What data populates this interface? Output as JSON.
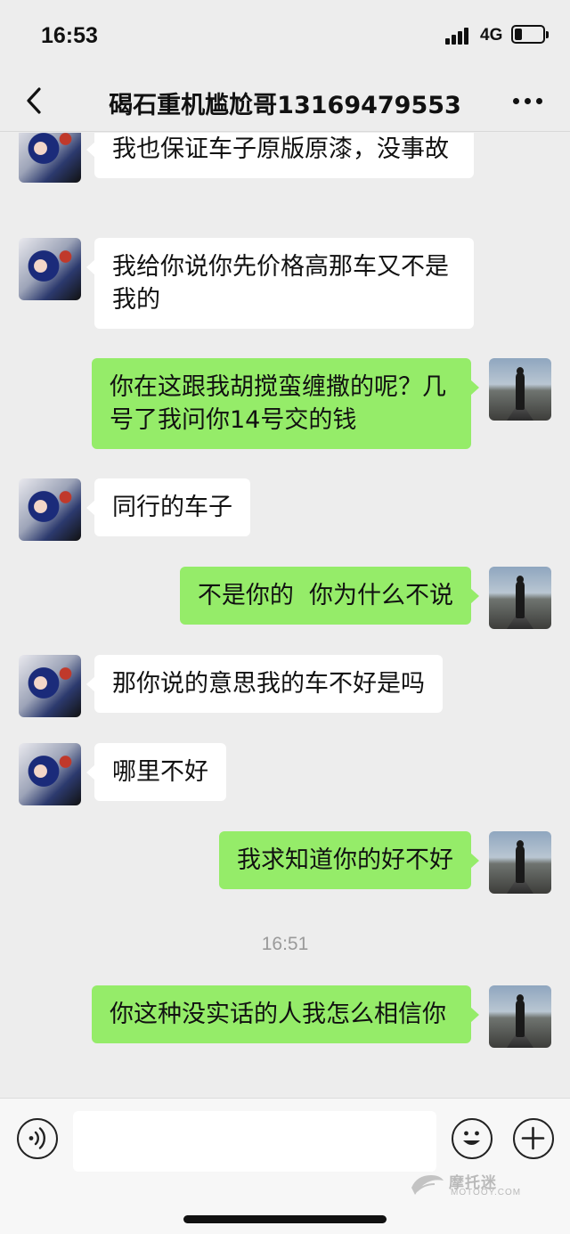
{
  "status_bar": {
    "time": "16:53",
    "network": "4G",
    "signal_level": 4,
    "battery_level": 0.25
  },
  "header": {
    "title": "碣石重机尴尬哥13169479553",
    "back_icon": "chevron-left-icon",
    "more_icon": "ellipsis-icon"
  },
  "messages": [
    {
      "side": "left",
      "text": "我也保证车子原版原漆，没事故"
    },
    {
      "side": "left",
      "text": "我给你说你先价格高那车又不是我的"
    },
    {
      "side": "right",
      "text": "你在这跟我胡搅蛮缠撒的呢？几号了我问你14号交的钱"
    },
    {
      "side": "left",
      "text": "同行的车子"
    },
    {
      "side": "right",
      "text": "不是你的  你为什么不说"
    },
    {
      "side": "left",
      "text": "那你说的意思我的车不好是吗"
    },
    {
      "side": "left",
      "text": "哪里不好"
    },
    {
      "side": "right",
      "text": "我求知道你的好不好"
    },
    {
      "side": "right",
      "text": "你这种没实话的人我怎么相信你"
    }
  ],
  "timestamp": "16:51",
  "input_bar": {
    "voice_icon": "voice-icon",
    "emoji_icon": "emoji-icon",
    "plus_icon": "plus-icon",
    "input_value": ""
  },
  "watermark": {
    "title": "摩托迷",
    "subtitle": "MOTOOY.COM"
  },
  "colors": {
    "background": "#ededed",
    "bubble_self": "#95ec69",
    "bubble_other": "#ffffff"
  }
}
